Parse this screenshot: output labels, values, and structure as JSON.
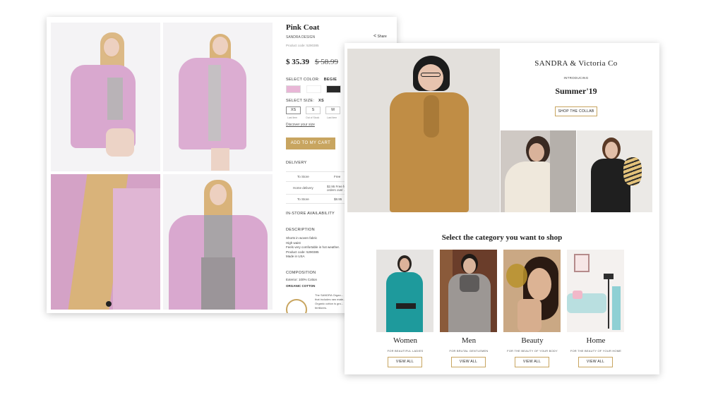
{
  "product": {
    "title": "Pink Coat",
    "brand": "SANDRA DESIGN",
    "share_label": "Share",
    "product_code": "Product code: 5290385",
    "price_current": "$ 35.39",
    "price_old": "$ 58.99",
    "select_color_label": "SELECT COLOR:",
    "selected_color": "BEGIE",
    "colors": [
      "#e8b6d6",
      "#ffffff",
      "#2a2a2a"
    ],
    "select_size_label": "SELECT SIZE:",
    "selected_size": "XS",
    "sizes": [
      {
        "label": "XS",
        "note": "Last item"
      },
      {
        "label": "S",
        "note": "Out of Stock"
      },
      {
        "label": "M",
        "note": "Last item"
      }
    ],
    "discover_size": "Discover your size",
    "add_to_cart": "ADD TO MY CART",
    "delivery_label": "DELIVERY",
    "delivery_rows": [
      {
        "method": "To Store",
        "price": "Free"
      },
      {
        "method": "Home delivery",
        "price": "$2.95  Free for orders over ..."
      },
      {
        "method": "To Store",
        "price": "$8.95"
      }
    ],
    "instore_label": "IN-STORE AVAILABILITY",
    "description_label": "DESCRIPTION",
    "description_lines": [
      "Shorts in woven fabric",
      "High waist",
      "Feels very comfortable in hot weather.",
      "Product code: 5290385",
      "Made in USA"
    ],
    "composition_label": "COMPOSITION",
    "composition_exterior": "Exterior: 100% Cotton",
    "organic_label": "ORGANIC COTTON",
    "organic_text_1": "The SANDRA Organ...",
    "organic_text_2": "that includes raw mate...",
    "organic_text_3": "Organic cotton is gro...",
    "organic_text_4": "fertilizers."
  },
  "landing": {
    "brand": "SANDRA & Victoria Co",
    "introducing": "INTRODUCING",
    "season": "Summer'19",
    "shop_collab": "SHOP THE COLLAB",
    "category_heading": "Select the category you want to shop",
    "categories": [
      {
        "name": "Women",
        "subtitle": "FOR BEAUTIFUL LADIES",
        "button": "VIEW ALL"
      },
      {
        "name": "Men",
        "subtitle": "FOR BRUTAL GENTLEMEN",
        "button": "VIEW ALL"
      },
      {
        "name": "Beauty",
        "subtitle": "FOR THE BEAUTY OF YOUR BODY",
        "button": "VIEW ALL"
      },
      {
        "name": "Home",
        "subtitle": "FOR THE BEAUTY OF YOUR HOME",
        "button": "VIEW ALL"
      }
    ]
  },
  "colors": {
    "accent_gold": "#c8a560",
    "coat_pink": "#d9a8cf",
    "mustard_dress": "#c08d45"
  }
}
